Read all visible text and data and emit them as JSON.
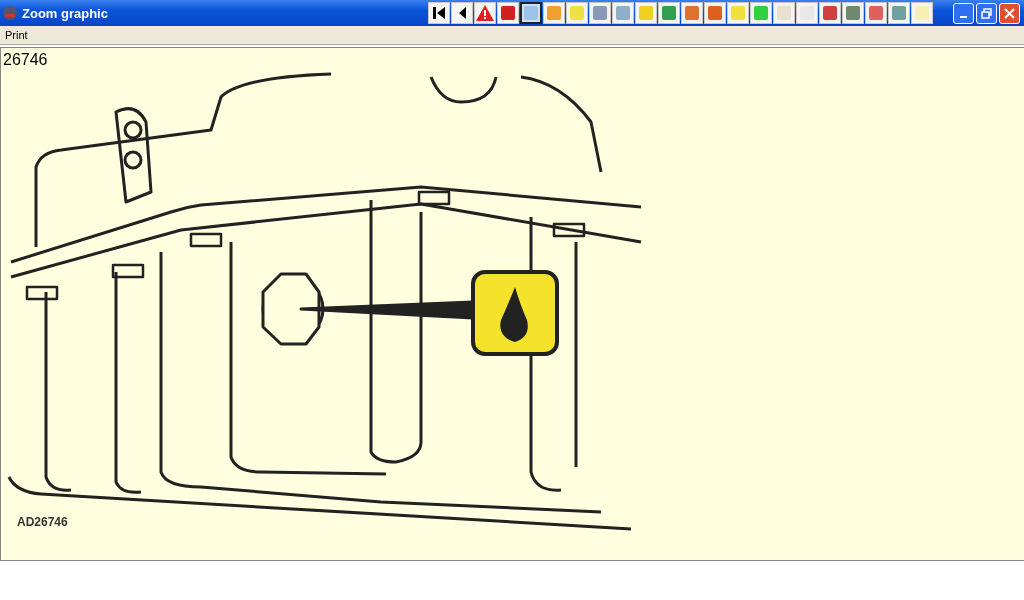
{
  "window": {
    "title": "Zoom graphic"
  },
  "toolbar": [
    {
      "kind": "first",
      "selected": false
    },
    {
      "kind": "prev",
      "selected": false
    },
    {
      "kind": "warning",
      "selected": false
    },
    {
      "kind": "picture",
      "color": "#d02020",
      "selected": false
    },
    {
      "kind": "picture",
      "color": "#9cc4e8",
      "selected": true
    },
    {
      "kind": "picture",
      "color": "#f0a030",
      "selected": false
    },
    {
      "kind": "picture",
      "color": "#f0e040",
      "selected": false
    },
    {
      "kind": "picture",
      "color": "#8898b8",
      "selected": false
    },
    {
      "kind": "picture",
      "color": "#90b0c8",
      "selected": false
    },
    {
      "kind": "picture",
      "color": "#f0d020",
      "selected": false
    },
    {
      "kind": "picture",
      "color": "#30a050",
      "selected": false
    },
    {
      "kind": "picture",
      "color": "#e07030",
      "selected": false
    },
    {
      "kind": "picture",
      "color": "#e06020",
      "selected": false
    },
    {
      "kind": "picture",
      "color": "#f0e040",
      "selected": false
    },
    {
      "kind": "picture",
      "color": "#30d040",
      "selected": false
    },
    {
      "kind": "picture",
      "color": "#e8e0d0",
      "selected": false
    },
    {
      "kind": "picture",
      "color": "#e8e8e8",
      "selected": false
    },
    {
      "kind": "picture",
      "color": "#d04040",
      "selected": false
    },
    {
      "kind": "picture",
      "color": "#708870",
      "selected": false
    },
    {
      "kind": "picture",
      "color": "#e06060",
      "selected": false
    },
    {
      "kind": "picture",
      "color": "#70a0a0",
      "selected": false
    },
    {
      "kind": "picture",
      "color": "#f8f0b0",
      "selected": false
    }
  ],
  "menu": [
    "Print"
  ],
  "graphic": {
    "heading": "26746",
    "caption": "AD26746"
  }
}
